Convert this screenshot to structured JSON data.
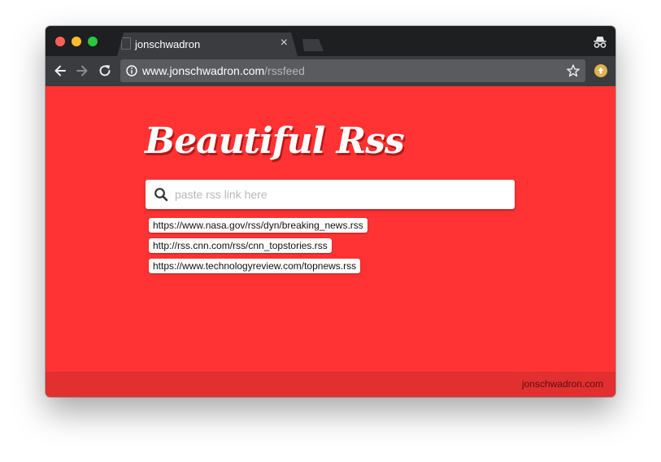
{
  "tab": {
    "title": "jonschwadron",
    "close_glyph": "×"
  },
  "address_bar": {
    "host": "www.jonschwadron.com",
    "path": "/rssfeed"
  },
  "icons": {
    "back": "back-arrow-icon",
    "forward": "forward-arrow-icon",
    "reload": "reload-icon",
    "info": "info-icon",
    "bookmark": "star-icon",
    "incognito": "incognito-icon",
    "extension": "extension-icon",
    "search": "search-icon"
  },
  "app": {
    "logo": "Beautiful Rss",
    "search_placeholder": "paste rss link here",
    "suggestions": [
      "https://www.nasa.gov/rss/dyn/breaking_news.rss",
      "http://rss.cnn.com/rss/cnn_topstories.rss",
      "https://www.technologyreview.com/topnews.rss"
    ],
    "footer_link": "jonschwadron.com"
  },
  "colors": {
    "page_background": "#ff3333",
    "footer_background": "#e22f2f",
    "chrome_dark": "#1e1f21",
    "chrome_toolbar": "#3b3c3f",
    "extension_badge": "#e1b24d"
  }
}
